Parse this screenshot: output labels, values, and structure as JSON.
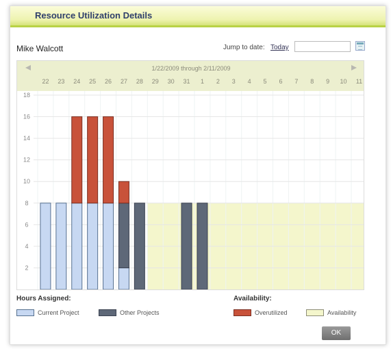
{
  "dialog": {
    "title": "Resource Utilization Details"
  },
  "resource": {
    "name": "Mike Walcott"
  },
  "jump": {
    "label": "Jump to date:",
    "today_label": "Today",
    "date_value": ""
  },
  "navigation": {
    "prev_icon": "triangle-left-icon",
    "next_icon": "triangle-right-icon",
    "range_label": "1/22/2009 through 2/11/2009"
  },
  "colors": {
    "current_project": "#c7d8f2",
    "other_projects": "#5e6878",
    "overutilized": "#c8523a",
    "availability": "#f4f6cc",
    "header_band": "#ecefcf",
    "title_bar_accent": "#b9d245"
  },
  "chart_data": {
    "type": "bar",
    "stacked": true,
    "categories": [
      "22",
      "23",
      "24",
      "25",
      "26",
      "27",
      "28",
      "29",
      "30",
      "31",
      "1",
      "2",
      "3",
      "4",
      "5",
      "6",
      "7",
      "8",
      "9",
      "10",
      "11"
    ],
    "y_ticks": [
      "2",
      "4",
      "6",
      "8",
      "10",
      "12",
      "14",
      "16",
      "18"
    ],
    "ylim": [
      0,
      18
    ],
    "availability_level": 8,
    "availability_start_index": 7,
    "series": [
      {
        "name": "Current Project",
        "values": [
          8,
          8,
          8,
          8,
          8,
          2,
          0,
          0,
          0,
          0,
          0,
          0,
          0,
          0,
          0,
          0,
          0,
          0,
          0,
          0,
          0
        ]
      },
      {
        "name": "Other Projects",
        "values": [
          0,
          0,
          0,
          0,
          0,
          6,
          8,
          0,
          0,
          8,
          8,
          0,
          0,
          0,
          0,
          0,
          0,
          0,
          0,
          0,
          0
        ]
      },
      {
        "name": "Overutilized",
        "values": [
          0,
          0,
          8,
          8,
          8,
          2,
          0,
          0,
          0,
          0,
          0,
          0,
          0,
          0,
          0,
          0,
          0,
          0,
          0,
          0,
          0
        ]
      }
    ]
  },
  "legend": {
    "hours_title": "Hours Assigned:",
    "current_project": "Current Project",
    "other_projects": "Other Projects",
    "availability_title": "Availability:",
    "overutilized": "Overutilized",
    "availability": "Availability"
  },
  "buttons": {
    "ok": "OK"
  }
}
